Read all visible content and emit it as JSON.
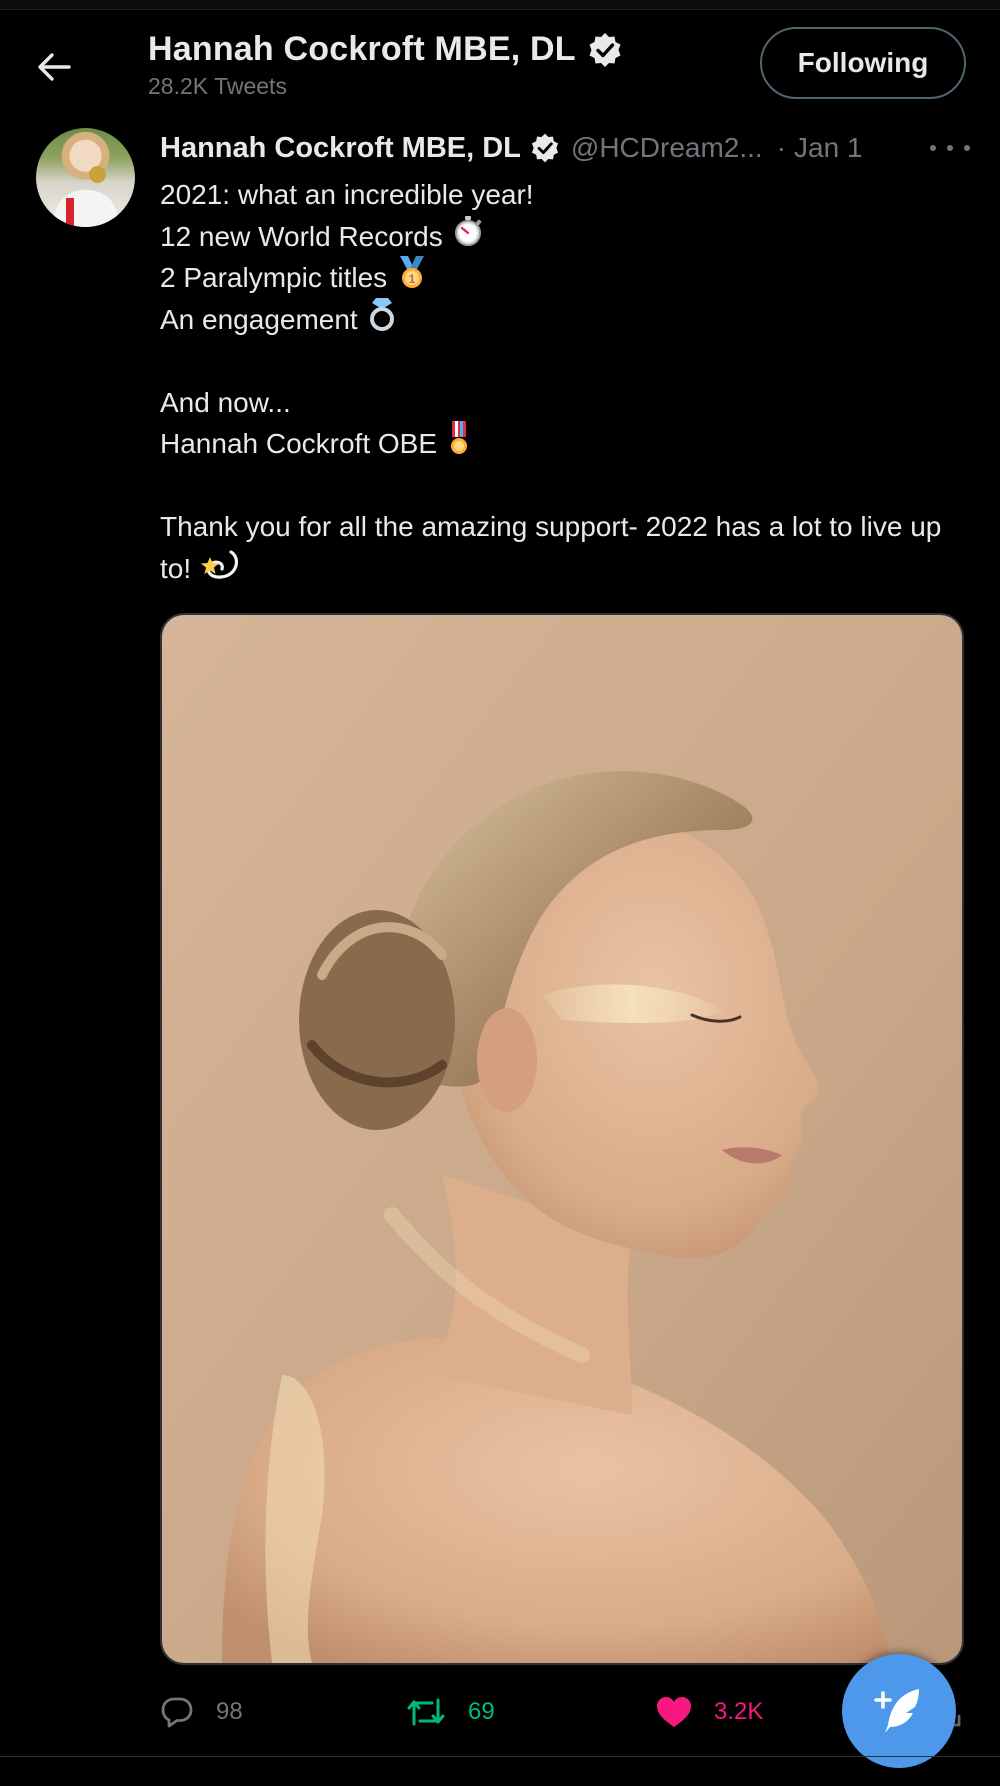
{
  "header": {
    "title": "Hannah Cockroft MBE, DL",
    "tweet_count": "28.2K Tweets",
    "follow_label": "Following"
  },
  "tweet": {
    "author_name": "Hannah Cockroft MBE, DL",
    "handle": "@HCDream2...",
    "separator": "·",
    "date": "Jan 1",
    "lines": [
      "2021: what an incredible year!",
      "12 new World Records",
      "2 Paralympic titles",
      "An engagement",
      "",
      "And now...",
      "Hannah Cockroft OBE",
      "",
      "Thank you for all the amazing support- 2022 has a lot to live up to!"
    ],
    "emojis": {
      "line_2": "stopwatch-emoji",
      "line_3": "first-place-medal-emoji",
      "line_4": "ring-emoji",
      "line_7": "military-medal-emoji",
      "line_9": "dizzy-emoji"
    }
  },
  "actions": {
    "replies": "98",
    "retweets": "69",
    "likes": "3.2K"
  },
  "icons": {
    "back": "back-arrow-icon",
    "verified": "verified-badge-icon",
    "more": "more-options-icon",
    "reply": "reply-icon",
    "retweet": "retweet-icon",
    "like": "heart-icon",
    "share": "share-icon",
    "compose": "compose-tweet-icon"
  },
  "colors": {
    "background": "#000000",
    "text_primary": "#e7e9ea",
    "text_secondary": "#71767b",
    "retweet_green": "#00ba7c",
    "like_pink": "#f91880",
    "compose_blue": "#4d98ea"
  }
}
